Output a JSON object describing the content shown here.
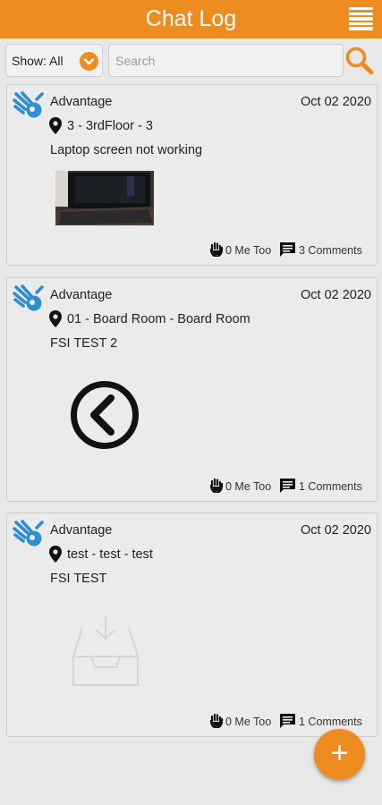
{
  "header": {
    "title": "Chat Log",
    "menu_icon": "hamburger-menu-icon"
  },
  "filter": {
    "show_label": "Show: All",
    "dropdown_icon": "chevron-down-icon",
    "search_placeholder": "Search",
    "search_value": "",
    "search_icon": "search-icon"
  },
  "colors": {
    "accent": "#ef8c1f",
    "logo_blue": "#2e8fcf",
    "background": "#e8e8e8"
  },
  "posts": [
    {
      "author": "Advantage",
      "date": "Oct 02 2020",
      "location": "3 - 3rdFloor - 3",
      "message": "Laptop screen not working",
      "attachment": "laptop-photo",
      "me_too": "0 Me Too",
      "comments": "3 Comments"
    },
    {
      "author": "Advantage",
      "date": "Oct 02 2020",
      "location": "01 - Board Room - Board Room",
      "message": "FSI TEST 2",
      "attachment": "back-arrow-circle-image",
      "me_too": "0 Me Too",
      "comments": "1 Comments"
    },
    {
      "author": "Advantage",
      "date": "Oct 02 2020",
      "location": "test - test - test",
      "message": "FSI TEST",
      "attachment": "inbox-tray-image",
      "me_too": "0 Me Too",
      "comments": "1 Comments"
    }
  ],
  "fab": {
    "label": "+",
    "icon": "add-icon"
  }
}
